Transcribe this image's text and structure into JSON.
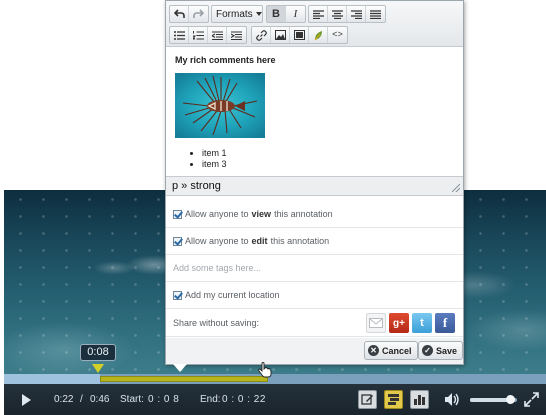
{
  "editor": {
    "toolbar": {
      "formats_label": "Formats",
      "bold_label": "B",
      "italic_label": "I",
      "source_label": "<>"
    },
    "content": {
      "heading": "My rich comments here",
      "list_items": [
        "item 1",
        "item 3"
      ]
    },
    "statusbar_path": "p » strong"
  },
  "options": {
    "view": {
      "before": "Allow anyone to",
      "bold": "view",
      "after": "this annotation",
      "checked": true
    },
    "edit": {
      "before": "Allow anyone to",
      "bold": "edit",
      "after": "this annotation",
      "checked": true
    },
    "tags_placeholder": "Add some tags here...",
    "location": {
      "label": "Add my current location",
      "checked": true
    },
    "share_label": "Share without saving:"
  },
  "share_icons": [
    "email-icon",
    "google-plus-icon",
    "twitter-icon",
    "facebook-icon"
  ],
  "share_glyphs": {
    "gplus": "g+",
    "twitter": "t",
    "facebook": "f"
  },
  "actions": {
    "cancel_label": "Cancel",
    "save_label": "Save"
  },
  "player": {
    "marker_time": "0:08",
    "current_time": "0:22",
    "separator": "/",
    "duration": "0:46",
    "start_label": "Start:",
    "start_value": "0 : 0 8",
    "end_label": "End:",
    "end_value": "0 : 0 : 22",
    "volume_level": 0.85
  },
  "colors": {
    "timeline_base": "#7aa0bd",
    "annotation_range": "#b7b51e",
    "controls_bg": "#1a242c",
    "sequence_button": "#e3c94a"
  }
}
